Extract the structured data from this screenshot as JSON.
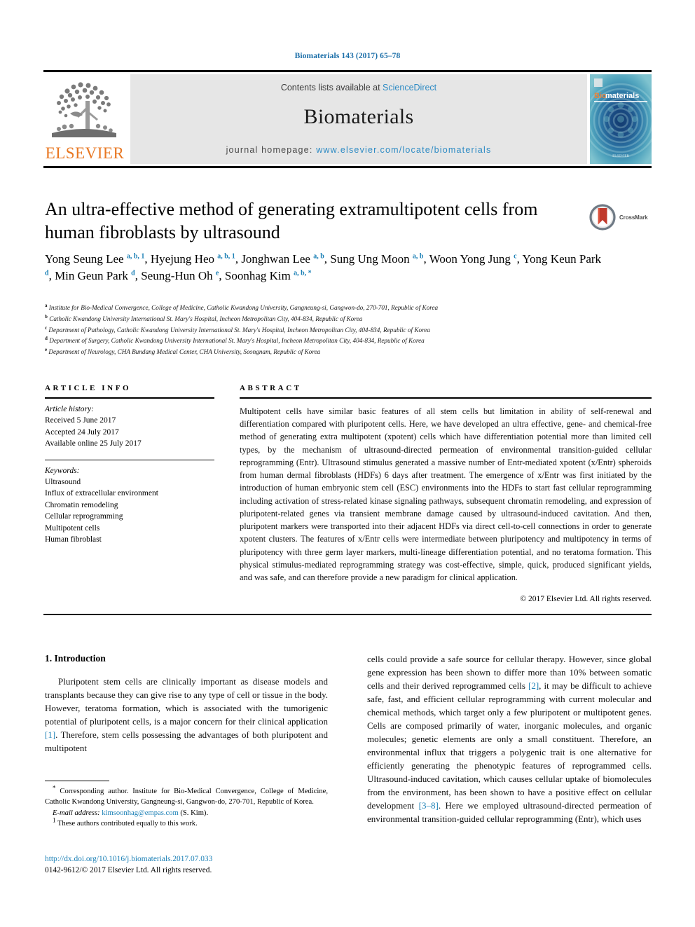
{
  "running_head": "Biomaterials 143 (2017) 65–78",
  "masthead": {
    "contents_prefix": "Contents lists available at ",
    "sciencedirect": "ScienceDirect",
    "journal_title": "Biomaterials",
    "homepage_prefix": "journal homepage: ",
    "homepage_url": "www.elsevier.com/locate/biomaterials",
    "publisher_wordmark": "ELSEVIER",
    "cover_title_a": "Bio",
    "cover_title_b": "materials",
    "cover_footer": "ELSEVIER"
  },
  "crossmark": {
    "label": "CrossMark"
  },
  "article": {
    "title": "An ultra-effective method of generating extramultipotent cells from human fibroblasts by ultrasound",
    "authors_html": "Yong Seung Lee <sup>a, b, 1</sup>, Hyejung Heo <sup>a, b, 1</sup>, Jonghwan Lee <sup>a, b</sup>, Sung Ung Moon <sup>a, b</sup>, Woon Yong Jung <sup>c</sup>, Yong Keun Park <sup>d</sup>, Min Geun Park <sup>d</sup>, Seung-Hun Oh <sup>e</sup>, Soonhag Kim <sup>a, b, *</sup>",
    "affiliations": [
      {
        "mark": "a",
        "text": "Institute for Bio-Medical Convergence, College of Medicine, Catholic Kwandong University, Gangneung-si, Gangwon-do, 270-701, Republic of Korea"
      },
      {
        "mark": "b",
        "text": "Catholic Kwandong University International St. Mary's Hospital, Incheon Metropolitan City, 404-834, Republic of Korea"
      },
      {
        "mark": "c",
        "text": "Department of Pathology, Catholic Kwandong University International St. Mary's Hospital, Incheon Metropolitan City, 404-834, Republic of Korea"
      },
      {
        "mark": "d",
        "text": "Department of Surgery, Catholic Kwandong University International St. Mary's Hospital, Incheon Metropolitan City, 404-834, Republic of Korea"
      },
      {
        "mark": "e",
        "text": "Department of Neurology, CHA Bundang Medical Center, CHA University, Seongnam, Republic of Korea"
      }
    ]
  },
  "article_info": {
    "heading": "ARTICLE INFO",
    "history_label": "Article history:",
    "history": [
      "Received 5 June 2017",
      "Accepted 24 July 2017",
      "Available online 25 July 2017"
    ],
    "keywords_label": "Keywords:",
    "keywords": [
      "Ultrasound",
      "Influx of extracellular environment",
      "Chromatin remodeling",
      "Cellular reprogramming",
      "Multipotent cells",
      "Human fibroblast"
    ]
  },
  "abstract": {
    "heading": "ABSTRACT",
    "text": "Multipotent cells have similar basic features of all stem cells but limitation in ability of self-renewal and differentiation compared with pluripotent cells. Here, we have developed an ultra effective, gene- and chemical-free method of generating extra multipotent (xpotent) cells which have differentiation potential more than limited cell types, by the mechanism of ultrasound-directed permeation of environmental transition-guided cellular reprogramming (Entr). Ultrasound stimulus generated a massive number of Entr-mediated xpotent (x/Entr) spheroids from human dermal fibroblasts (HDFs) 6 days after treatment. The emergence of x/Entr was first initiated by the introduction of human embryonic stem cell (ESC) environments into the HDFs to start fast cellular reprogramming including activation of stress-related kinase signaling pathways, subsequent chromatin remodeling, and expression of pluripotent-related genes via transient membrane damage caused by ultrasound-induced cavitation. And then, pluripotent markers were transported into their adjacent HDFs via direct cell-to-cell connections in order to generate xpotent clusters. The features of x/Entr cells were intermediate between pluripotency and multipotency in terms of pluripotency with three germ layer markers, multi-lineage differentiation potential, and no teratoma formation. This physical stimulus-mediated reprogramming strategy was cost-effective, simple, quick, produced significant yields, and was safe, and can therefore provide a new paradigm for clinical application.",
    "copyright": "© 2017 Elsevier Ltd. All rights reserved."
  },
  "body": {
    "section_number_title": "1. Introduction",
    "left_paragraph_pre": "Pluripotent stem cells are clinically important as disease models and transplants because they can give rise to any type of cell or tissue in the body. However, teratoma formation, which is associated with the tumorigenic potential of pluripotent cells, is a major concern for their clinical application ",
    "left_ref_1": "[1]",
    "left_paragraph_post": ". Therefore, stem cells possessing the advantages of both pluripotent and multipotent",
    "right_pre_ref2": "cells could provide a safe source for cellular therapy. However, since global gene expression has been shown to differ more than 10% between somatic cells and their derived reprogrammed cells ",
    "right_ref_2": "[2]",
    "right_mid": ", it may be difficult to achieve safe, fast, and efficient cellular reprogramming with current molecular and chemical methods, which target only a few pluripotent or multipotent genes. Cells are composed primarily of water, inorganic molecules, and organic molecules; genetic elements are only a small constituent. Therefore, an environmental influx that triggers a polygenic trait is one alternative for efficiently generating the phenotypic features of reprogrammed cells. Ultrasound-induced cavitation, which causes cellular uptake of biomolecules from the environment, has been shown to have a positive effect on cellular development ",
    "right_ref_3": "[3–8]",
    "right_post": ". Here we employed ultrasound-directed permeation of environmental transition-guided cellular reprogramming (Entr), which uses"
  },
  "footnotes": {
    "corresponding_mark": "*",
    "corresponding": " Corresponding author. Institute for Bio-Medical Convergence, College of Medicine, Catholic Kwandong University, Gangneung-si, Gangwon-do, 270-701, Republic of Korea.",
    "email_label": "E-mail address:",
    "email": "kimsoonhag@empas.com",
    "email_suffix": " (S. Kim).",
    "equal_mark": "1",
    "equal_contrib": " These authors contributed equally to this work."
  },
  "footer": {
    "doi": "http://dx.doi.org/10.1016/j.biomaterials.2017.07.033",
    "issn": "0142-9612/© 2017 Elsevier Ltd. All rights reserved."
  },
  "colors": {
    "link": "#1a7fb5",
    "sciencedirect": "#2e8bc4",
    "elsevier_orange": "#E87722",
    "masthead_bg": "#e6e6e6"
  }
}
